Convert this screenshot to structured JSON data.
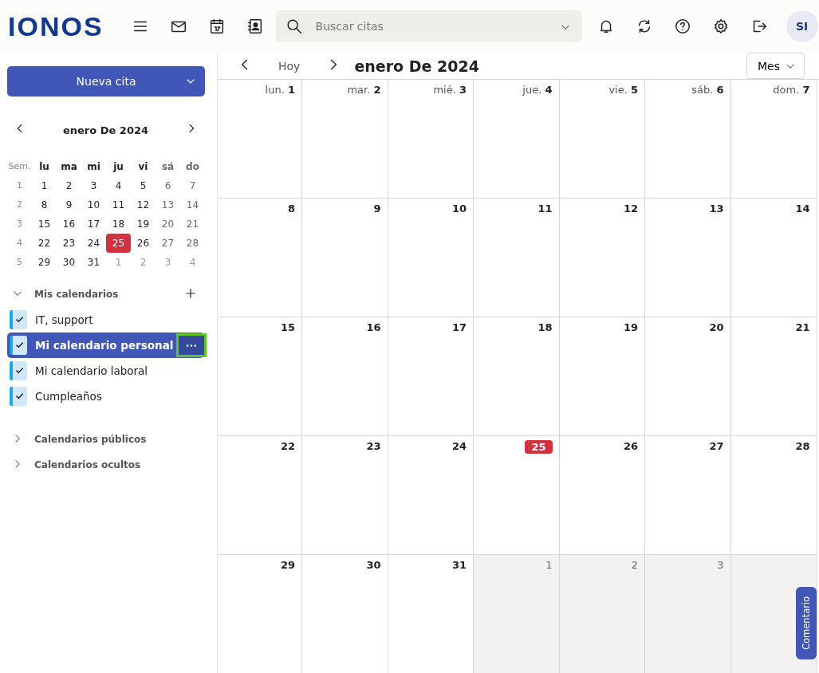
{
  "header": {
    "logo": "IONOS",
    "search": {
      "placeholder": "Buscar citas"
    },
    "avatar": "SI"
  },
  "sidebar": {
    "new_button": "Nueva cita",
    "mini_calendar": {
      "title": "enero De 2024",
      "week_label": "Sem.",
      "weekdays": [
        "lu",
        "ma",
        "mi",
        "ju",
        "vi",
        "sá",
        "do"
      ],
      "weeks": [
        {
          "week": "1",
          "days": [
            {
              "day": "1",
              "outside": false,
              "today": false
            },
            {
              "day": "2",
              "outside": false,
              "today": false
            },
            {
              "day": "3",
              "outside": false,
              "today": false
            },
            {
              "day": "4",
              "outside": false,
              "today": false
            },
            {
              "day": "5",
              "outside": false,
              "today": false
            },
            {
              "day": "6",
              "outside": false,
              "today": false
            },
            {
              "day": "7",
              "outside": false,
              "today": false
            }
          ]
        },
        {
          "week": "2",
          "days": [
            {
              "day": "8",
              "outside": false,
              "today": false
            },
            {
              "day": "9",
              "outside": false,
              "today": false
            },
            {
              "day": "10",
              "outside": false,
              "today": false
            },
            {
              "day": "11",
              "outside": false,
              "today": false
            },
            {
              "day": "12",
              "outside": false,
              "today": false
            },
            {
              "day": "13",
              "outside": false,
              "today": false
            },
            {
              "day": "14",
              "outside": false,
              "today": false
            }
          ]
        },
        {
          "week": "3",
          "days": [
            {
              "day": "15",
              "outside": false,
              "today": false
            },
            {
              "day": "16",
              "outside": false,
              "today": false
            },
            {
              "day": "17",
              "outside": false,
              "today": false
            },
            {
              "day": "18",
              "outside": false,
              "today": false
            },
            {
              "day": "19",
              "outside": false,
              "today": false
            },
            {
              "day": "20",
              "outside": false,
              "today": false
            },
            {
              "day": "21",
              "outside": false,
              "today": false
            }
          ]
        },
        {
          "week": "4",
          "days": [
            {
              "day": "22",
              "outside": false,
              "today": false
            },
            {
              "day": "23",
              "outside": false,
              "today": false
            },
            {
              "day": "24",
              "outside": false,
              "today": false
            },
            {
              "day": "25",
              "outside": false,
              "today": true
            },
            {
              "day": "26",
              "outside": false,
              "today": false
            },
            {
              "day": "27",
              "outside": false,
              "today": false
            },
            {
              "day": "28",
              "outside": false,
              "today": false
            }
          ]
        },
        {
          "week": "5",
          "days": [
            {
              "day": "29",
              "outside": false,
              "today": false
            },
            {
              "day": "30",
              "outside": false,
              "today": false
            },
            {
              "day": "31",
              "outside": false,
              "today": false
            },
            {
              "day": "1",
              "outside": true,
              "today": false
            },
            {
              "day": "2",
              "outside": true,
              "today": false
            },
            {
              "day": "3",
              "outside": true,
              "today": false
            },
            {
              "day": "4",
              "outside": true,
              "today": false
            }
          ]
        }
      ]
    },
    "groups": [
      {
        "label": "Mis calendarios",
        "expanded": true,
        "items": [
          {
            "label": "IT, support",
            "checked": true,
            "selected": false,
            "color": "#1fa6e8"
          },
          {
            "label": "Mi calendario personal",
            "checked": true,
            "selected": true,
            "color": "#1fa6e8"
          },
          {
            "label": "Mi calendario laboral",
            "checked": true,
            "selected": false,
            "color": "#1fa6e8"
          },
          {
            "label": "Cumpleaños",
            "checked": true,
            "selected": false,
            "color": "#1fa6e8"
          }
        ]
      },
      {
        "label": "Calendarios públicos",
        "expanded": false
      },
      {
        "label": "Calendarios ocultos",
        "expanded": false
      }
    ]
  },
  "main": {
    "today_button": "Hoy",
    "title": "enero De 2024",
    "view": "Mes",
    "weekdays": [
      "lun.",
      "mar.",
      "mié.",
      "jue.",
      "vie.",
      "sáb.",
      "dom."
    ],
    "weeks": [
      [
        {
          "day": "1",
          "outside": false,
          "today": false
        },
        {
          "day": "2",
          "outside": false,
          "today": false
        },
        {
          "day": "3",
          "outside": false,
          "today": false
        },
        {
          "day": "4",
          "outside": false,
          "today": false
        },
        {
          "day": "5",
          "outside": false,
          "today": false
        },
        {
          "day": "6",
          "outside": false,
          "today": false
        },
        {
          "day": "7",
          "outside": false,
          "today": false
        }
      ],
      [
        {
          "day": "8",
          "outside": false,
          "today": false
        },
        {
          "day": "9",
          "outside": false,
          "today": false
        },
        {
          "day": "10",
          "outside": false,
          "today": false
        },
        {
          "day": "11",
          "outside": false,
          "today": false
        },
        {
          "day": "12",
          "outside": false,
          "today": false
        },
        {
          "day": "13",
          "outside": false,
          "today": false
        },
        {
          "day": "14",
          "outside": false,
          "today": false
        }
      ],
      [
        {
          "day": "15",
          "outside": false,
          "today": false
        },
        {
          "day": "16",
          "outside": false,
          "today": false
        },
        {
          "day": "17",
          "outside": false,
          "today": false
        },
        {
          "day": "18",
          "outside": false,
          "today": false
        },
        {
          "day": "19",
          "outside": false,
          "today": false
        },
        {
          "day": "20",
          "outside": false,
          "today": false
        },
        {
          "day": "21",
          "outside": false,
          "today": false
        }
      ],
      [
        {
          "day": "22",
          "outside": false,
          "today": false
        },
        {
          "day": "23",
          "outside": false,
          "today": false
        },
        {
          "day": "24",
          "outside": false,
          "today": false
        },
        {
          "day": "25",
          "outside": false,
          "today": true
        },
        {
          "day": "26",
          "outside": false,
          "today": false
        },
        {
          "day": "27",
          "outside": false,
          "today": false
        },
        {
          "day": "28",
          "outside": false,
          "today": false
        }
      ],
      [
        {
          "day": "29",
          "outside": false,
          "today": false
        },
        {
          "day": "30",
          "outside": false,
          "today": false
        },
        {
          "day": "31",
          "outside": false,
          "today": false
        },
        {
          "day": "1",
          "outside": true,
          "today": false
        },
        {
          "day": "2",
          "outside": true,
          "today": false
        },
        {
          "day": "3",
          "outside": true,
          "today": false
        },
        {
          "outside": true,
          "today": false
        }
      ]
    ]
  },
  "feedback": "Comentario"
}
